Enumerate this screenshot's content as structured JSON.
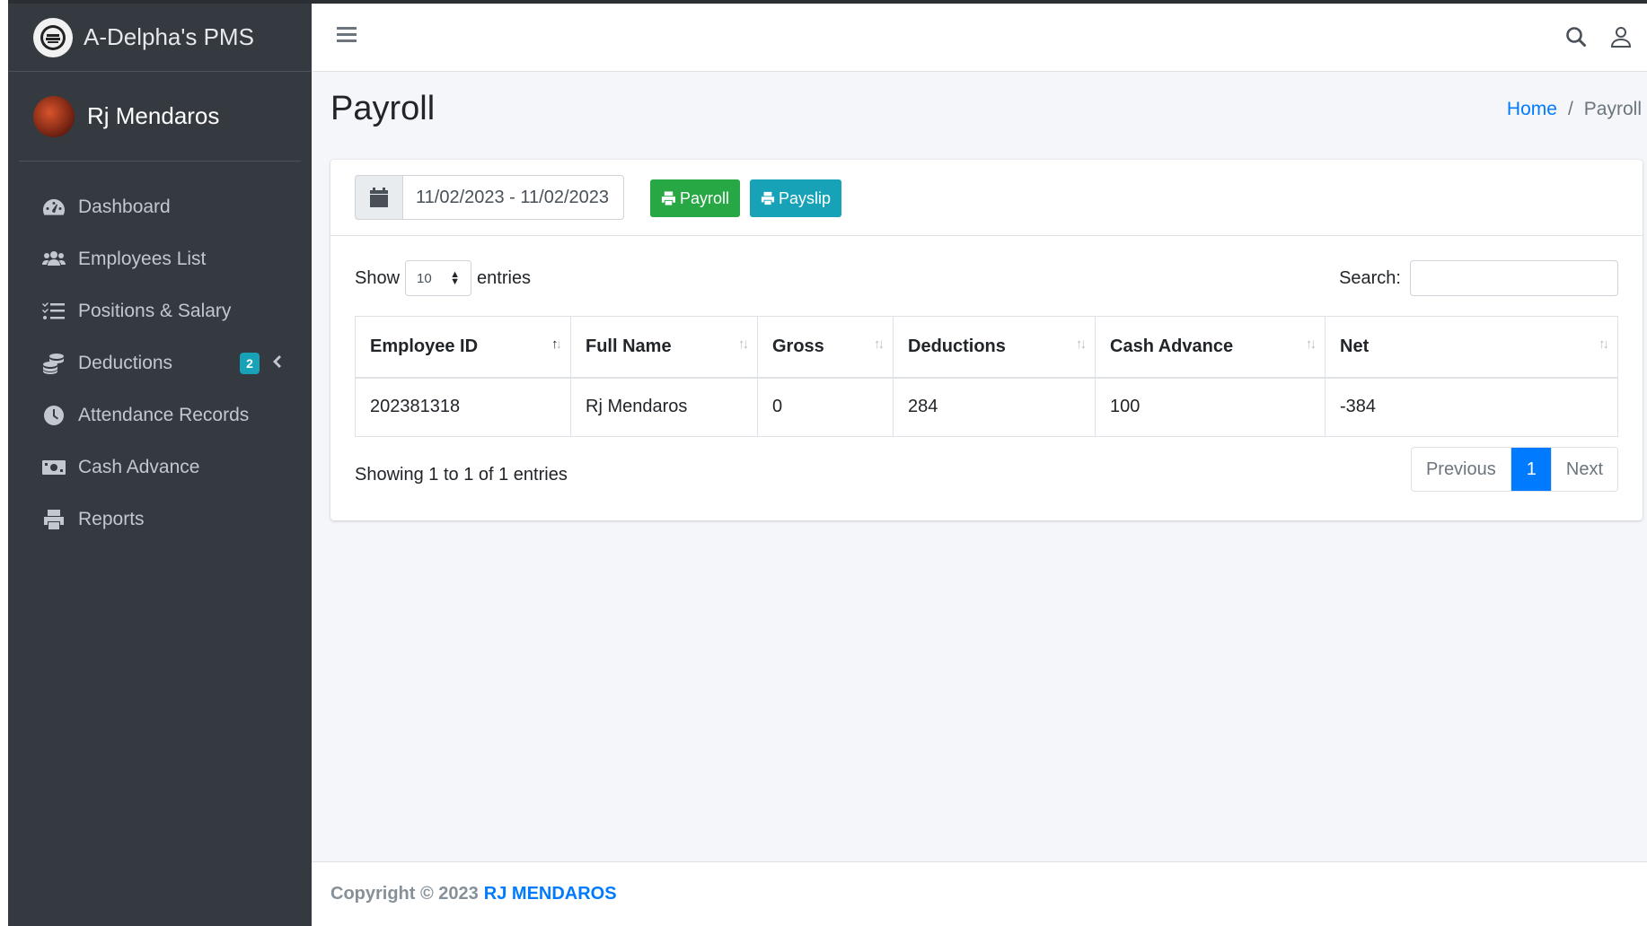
{
  "brand": {
    "name": "A-Delpha's PMS"
  },
  "user": {
    "name": "Rj Mendaros"
  },
  "sidebar": {
    "items": [
      {
        "label": "Dashboard",
        "icon": "tachometer-icon"
      },
      {
        "label": "Employees List",
        "icon": "users-icon"
      },
      {
        "label": "Positions & Salary",
        "icon": "list-icon"
      },
      {
        "label": "Deductions",
        "icon": "coins-icon",
        "badge": "2"
      },
      {
        "label": "Attendance Records",
        "icon": "clock-icon"
      },
      {
        "label": "Cash Advance",
        "icon": "money-icon"
      },
      {
        "label": "Reports",
        "icon": "print-icon"
      }
    ]
  },
  "header": {
    "title": "Payroll",
    "breadcrumb": {
      "home": "Home",
      "separator": "/",
      "current": "Payroll"
    }
  },
  "toolbar": {
    "date_range": "11/02/2023 - 11/02/2023",
    "payroll_label": "Payroll",
    "payslip_label": "Payslip"
  },
  "table_controls": {
    "show_label": "Show",
    "entries_value": "10",
    "entries_label": "entries",
    "search_label": "Search:"
  },
  "table": {
    "columns": [
      "Employee ID",
      "Full Name",
      "Gross",
      "Deductions",
      "Cash Advance",
      "Net"
    ],
    "rows": [
      [
        "202381318",
        "Rj Mendaros",
        "0",
        "284",
        "100",
        "-384"
      ]
    ]
  },
  "pagination": {
    "info": "Showing 1 to 1 of 1 entries",
    "previous": "Previous",
    "current": "1",
    "next": "Next"
  },
  "footer": {
    "prefix": "Copyright © 2023",
    "owner": "RJ MENDAROS"
  },
  "colors": {
    "sidebar": "#343a40",
    "primary": "#007bff",
    "success": "#28a745",
    "info": "#17a2b8"
  }
}
